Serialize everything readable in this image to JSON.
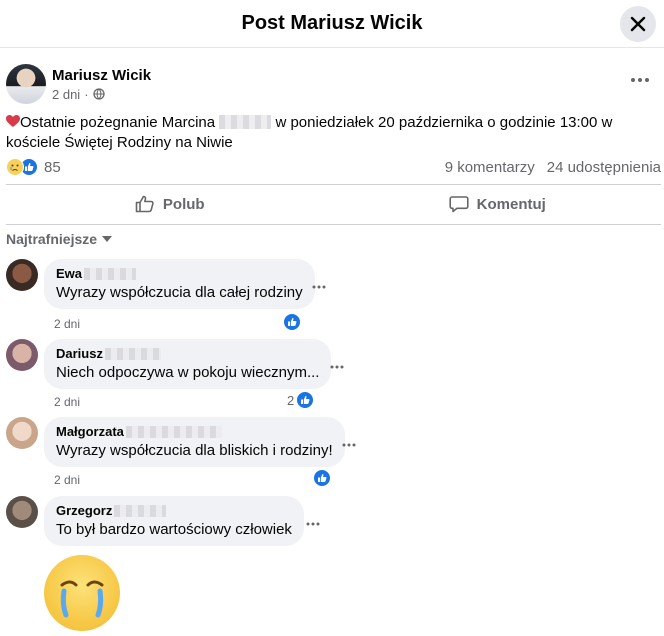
{
  "header": {
    "title": "Post Mariusz Wicik"
  },
  "post": {
    "author": "Mariusz Wicik",
    "time": "2 dni",
    "text_before": "Ostatnie pożegnanie Marcina",
    "text_after": "w poniedziałek 20 października o godzinie 13:00 w kościele Świętej Rodziny na Niwie",
    "reaction_count": "85",
    "comments_count": "9 komentarzy",
    "shares_count": "24 udostępnienia"
  },
  "actions": {
    "like_label": "Polub",
    "comment_label": "Komentuj"
  },
  "sort": {
    "label": "Najtrafniejsze"
  },
  "comments": [
    {
      "name": "Ewa",
      "text": "Wyrazy współczucia dla całej rodziny",
      "time": "2 dni",
      "likes": ""
    },
    {
      "name": "Dariusz",
      "text": "Niech odpoczywa w pokoju wiecznym...",
      "time": "2 dni",
      "likes": "2"
    },
    {
      "name": "Małgorzata",
      "text": "Wyrazy współczucia dla bliskich i rodziny!",
      "time": "2 dni",
      "likes": ""
    },
    {
      "name": "Grzegorz",
      "text": "To był bardzo wartościowy człowiek",
      "time": "",
      "likes": ""
    }
  ],
  "colors": {
    "accent": "#1b74e4",
    "secondary_text": "#65676b",
    "bubble": "#f0f2f5"
  },
  "icons": [
    "close-icon",
    "globe-icon",
    "heart-icon",
    "like-icon",
    "comment-icon",
    "chevron-down-icon",
    "more-icon",
    "sad-emoji-icon"
  ]
}
